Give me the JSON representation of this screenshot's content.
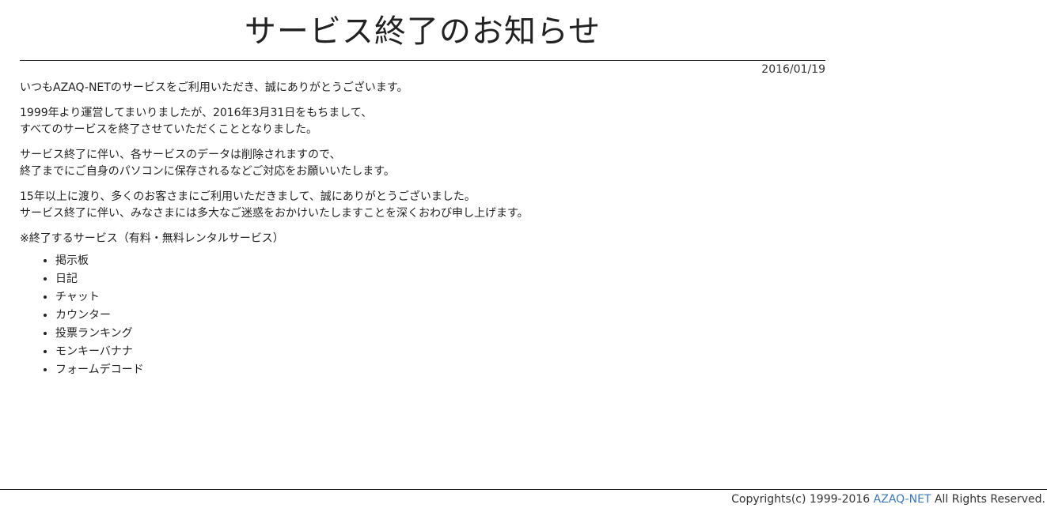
{
  "page": {
    "title": "サービス終了のお知らせ",
    "date": "2016/01/19"
  },
  "notice": {
    "para1": "いつもAZAQ-NETのサービスをご利用いただき、誠にありがとうございます。",
    "para2_line1": "1999年より運営してまいりましたが、2016年3月31日をもちまして、",
    "para2_line2": "すべてのサービスを終了させていただくこととなりました。",
    "para3_line1": "サービス終了に伴い、各サービスのデータは削除されますので、",
    "para3_line2": "終了までにご自身のパソコンに保存されるなどご対応をお願いいたします。",
    "para4_line1": "15年以上に渡り、多くのお客さまにご利用いただきまして、誠にありがとうございました。",
    "para4_line2": "サービス終了に伴い、みなさまには多大なご迷惑をおかけいたしますことを深くおわび申し上げます。",
    "services_heading": "※終了するサービス（有料・無料レンタルサービス）",
    "services": [
      "掲示板",
      "日記",
      "チャット",
      "カウンター",
      "投票ランキング",
      "モンキーバナナ",
      "フォームデコード"
    ]
  },
  "footer": {
    "prefix": "Copyrights(c) 1999-2016 ",
    "link": "AZAQ-NET",
    "suffix": " All Rights Reserved."
  },
  "colors": {
    "text": "#222222",
    "link": "#3a78b8"
  }
}
